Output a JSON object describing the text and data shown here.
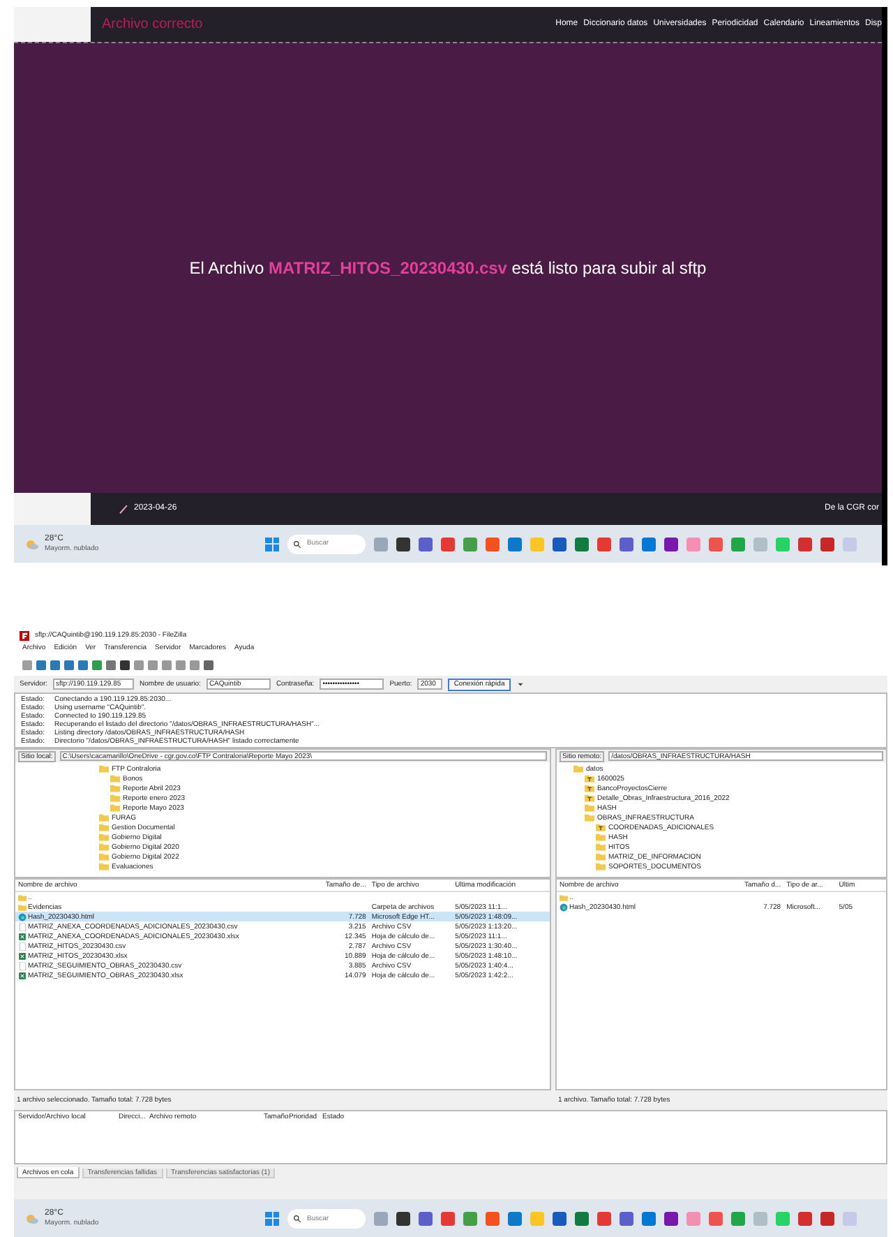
{
  "web_page": {
    "brand": "Archivo correcto",
    "nav": [
      "Home",
      "Diccionario datos",
      "Universidades",
      "Periodicidad",
      "Calendario",
      "Lineamientos",
      "Disp"
    ],
    "message": {
      "prefix": "El Archivo",
      "file": "MATRIZ_HITOS_20230430.csv",
      "suffix": "está listo para subir al sftp"
    },
    "footer": {
      "date": "2023-04-26",
      "text": "De la CGR cor"
    }
  },
  "taskbar_top": {
    "weather_temp": "28°C",
    "weather_desc": "Mayorm. nublado",
    "search_placeholder": "Buscar"
  },
  "filezilla": {
    "title": "sftp://CAQuintib@190.119.129.85:2030 - FileZilla",
    "menu": [
      "Archivo",
      "Edición",
      "Ver",
      "Transferencia",
      "Servidor",
      "Marcadores",
      "Ayuda"
    ],
    "quickconnect": {
      "host_label": "Servidor:",
      "host": "sftp://190.119.129.85",
      "user_label": "Nombre de usuario:",
      "user": "CAQuintib",
      "password_label": "Contraseña:",
      "password": "•••••••••••••••",
      "port_label": "Puerto:",
      "port": "2030",
      "button": "Conexión rápida"
    },
    "log": [
      {
        "label": "Estado:",
        "text": "Conectando a 190.119.129.85:2030..."
      },
      {
        "label": "Estado:",
        "text": "Using username \"CAQuintib\"."
      },
      {
        "label": "Estado:",
        "text": "Connected to 190.119.129.85"
      },
      {
        "label": "Estado:",
        "text": "Recuperando el listado del directorio \"/datos/OBRAS_INFRAESTRUCTURA/HASH\"..."
      },
      {
        "label": "Estado:",
        "text": "Listing directory /datos/OBRAS_INFRAESTRUCTURA/HASH"
      },
      {
        "label": "Estado:",
        "text": "Directorio \"/datos/OBRAS_INFRAESTRUCTURA/HASH\" listado correctamente"
      }
    ],
    "local_site": {
      "label": "Sitio local:",
      "path": "C:\\Users\\cacamarillo\\OneDrive - cgr.gov.co\\FTP Contraloria\\Reporte Mayo 2023\\",
      "tree": [
        {
          "name": "FTP Contraloria",
          "kind": "folder",
          "children": [
            {
              "name": "Bonos",
              "kind": "folder"
            },
            {
              "name": "Reporte Abril 2023",
              "kind": "folder"
            },
            {
              "name": "Reporte enero 2023",
              "kind": "folder"
            },
            {
              "name": "Reporte Mayo 2023",
              "kind": "folder"
            }
          ]
        },
        {
          "name": "FURAG",
          "kind": "folder"
        },
        {
          "name": "Gestion Documental",
          "kind": "folder"
        },
        {
          "name": "Gobierno Digital",
          "kind": "folder"
        },
        {
          "name": "Gobierno Digital 2020",
          "kind": "folder"
        },
        {
          "name": "Gobierno Digital 2022",
          "kind": "folder"
        },
        {
          "name": "Evaluaciones",
          "kind": "folder"
        }
      ]
    },
    "remote_site": {
      "label": "Sitio remoto:",
      "path": "/datos/OBRAS_INFRAESTRUCTURA/HASH",
      "tree": [
        {
          "name": "datos",
          "kind": "folder",
          "children": [
            {
              "name": "1600025",
              "kind": "unknown"
            },
            {
              "name": "BancoProyectosCierre",
              "kind": "unknown"
            },
            {
              "name": "Detalle_Obras_Infraestructura_2016_2022",
              "kind": "unknown"
            },
            {
              "name": "HASH",
              "kind": "folder"
            },
            {
              "name": "OBRAS_INFRAESTRUCTURA",
              "kind": "folder",
              "children": [
                {
                  "name": "COORDENADAS_ADICIONALES",
                  "kind": "unknown"
                },
                {
                  "name": "HASH",
                  "kind": "folder"
                },
                {
                  "name": "HITOS",
                  "kind": "folder"
                },
                {
                  "name": "MATRIZ_DE_INFORMACION",
                  "kind": "folder"
                },
                {
                  "name": "SOPORTES_DOCUMENTOS",
                  "kind": "folder"
                }
              ]
            }
          ]
        }
      ]
    },
    "local_files": {
      "columns": [
        "Nombre de archivo",
        "Tamaño de...",
        "Tipo de archivo",
        "Última modificación"
      ],
      "rows": [
        {
          "kind": "folder",
          "cells": [
            "..",
            "",
            "",
            ""
          ],
          "selected": false
        },
        {
          "kind": "folder",
          "cells": [
            "Evidencias",
            "",
            "Carpeta de archivos",
            "5/05/2023 11:1..."
          ],
          "selected": false
        },
        {
          "kind": "html",
          "cells": [
            "Hash_20230430.html",
            "7.728",
            "Microsoft Edge HT...",
            "5/05/2023 1:48:09..."
          ],
          "selected": true
        },
        {
          "kind": "csv",
          "cells": [
            "MATRIZ_ANEXA_COORDENADAS_ADICIONALES_20230430.csv",
            "3.215",
            "Archivo CSV",
            "5/05/2023 1:13:20..."
          ],
          "selected": false
        },
        {
          "kind": "xlsx",
          "cells": [
            "MATRIZ_ANEXA_COORDENADAS_ADICIONALES_20230430.xlsx",
            "12.345",
            "Hoja de cálculo de...",
            "5/05/2023 11:1..."
          ],
          "selected": false
        },
        {
          "kind": "csv",
          "cells": [
            "MATRIZ_HITOS_20230430.csv",
            "2.787",
            "Archivo CSV",
            "5/05/2023 1:30:40..."
          ],
          "selected": false
        },
        {
          "kind": "xlsx",
          "cells": [
            "MATRIZ_HITOS_20230430.xlsx",
            "10.889",
            "Hoja de cálculo de...",
            "5/05/2023 1:48:10..."
          ],
          "selected": false
        },
        {
          "kind": "csv",
          "cells": [
            "MATRIZ_SEGUIMIENTO_OBRAS_20230430.csv",
            "3.885",
            "Archivo CSV",
            "5/05/2023 1:40:4..."
          ],
          "selected": false
        },
        {
          "kind": "xlsx",
          "cells": [
            "MATRIZ_SEGUIMIENTO_OBRAS_20230430.xlsx",
            "14.079",
            "Hoja de cálculo de...",
            "5/05/2023 1:42:2..."
          ],
          "selected": false
        }
      ],
      "status": "1 archivo seleccionado. Tamaño total: 7.728 bytes"
    },
    "remote_files": {
      "columns": [
        "Nombre de archivo",
        "Tamaño d...",
        "Tipo de ar...",
        "Últim"
      ],
      "rows": [
        {
          "kind": "folder",
          "cells": [
            "..",
            "",
            "",
            ""
          ],
          "selected": false
        },
        {
          "kind": "html",
          "cells": [
            "Hash_20230430.html",
            "7.728",
            "Microsoft...",
            "5/05"
          ],
          "selected": false
        }
      ],
      "status": "1 archivo. Tamaño total: 7.728 bytes"
    },
    "queue_columns": [
      "Servidor/Archivo local",
      "Direcci...",
      "Archivo remoto",
      "Tamaño",
      "Prioridad",
      "Estado"
    ],
    "tabs": [
      {
        "label": "Archivos en cola",
        "selected": true
      },
      {
        "label": "Transferencias fallidas",
        "selected": false
      },
      {
        "label": "Transferencias satisfactorias (1)",
        "selected": false
      }
    ]
  },
  "taskbar_bottom": {
    "weather_temp": "28°C",
    "weather_desc": "Mayorm. nublado",
    "search_placeholder": "Buscar"
  }
}
